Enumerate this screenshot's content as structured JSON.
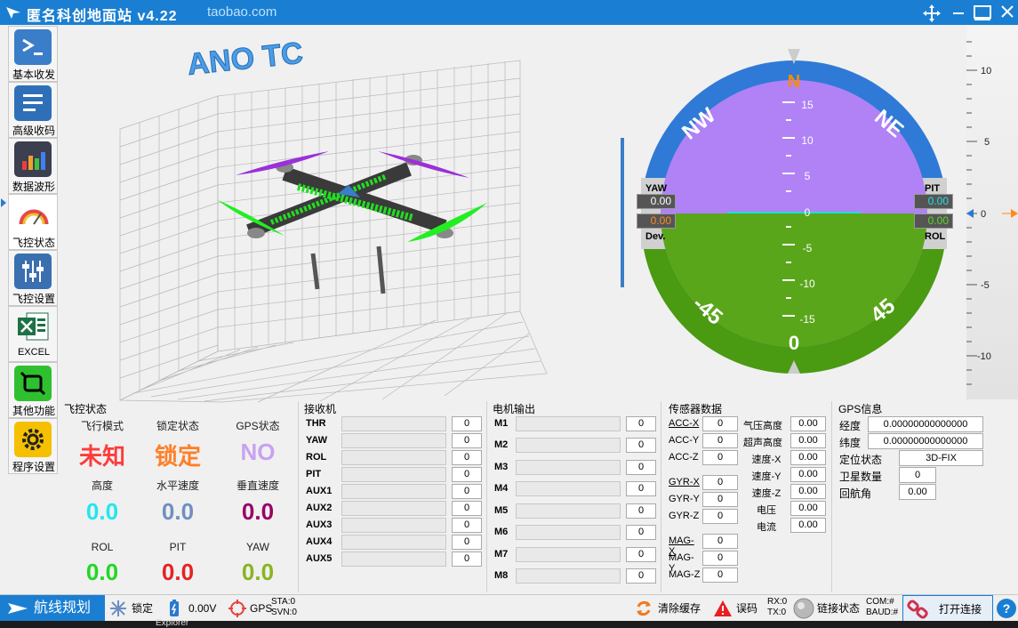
{
  "window": {
    "title": "匿名科创地面站 v4.22",
    "subtitle": "taobao.com"
  },
  "sidebar": {
    "items": [
      {
        "label": "基本收发"
      },
      {
        "label": "高级收码"
      },
      {
        "label": "数据波形"
      },
      {
        "label": "飞控状态"
      },
      {
        "label": "飞控设置"
      },
      {
        "label": "EXCEL"
      },
      {
        "label": "其他功能"
      },
      {
        "label": "程序设置"
      }
    ]
  },
  "view3d": {
    "logo": "ANO TC"
  },
  "hud": {
    "compass": [
      "N",
      "NE",
      "NW"
    ],
    "pitch_ticks": [
      "15",
      "10",
      "5",
      "0",
      "-5",
      "-10",
      "-15"
    ],
    "roll_labels": [
      "-45",
      "0",
      "45"
    ],
    "yaw_label": "YAW",
    "yaw_value": "0.00",
    "dev_value": "0.00",
    "dev_label": "Dev.",
    "pit_label": "PIT",
    "pit_value": "0.00",
    "rol_label": "ROL",
    "rol_value": "0.00"
  },
  "scale": {
    "ticks": [
      "10",
      "5",
      "0",
      "-5",
      "-10"
    ]
  },
  "flight_status": {
    "title": "飞控状态",
    "cells": [
      {
        "label": "飞行模式",
        "value": "未知",
        "color": "#ff3b3b"
      },
      {
        "label": "锁定状态",
        "value": "锁定",
        "color": "#ff7f27"
      },
      {
        "label": "GPS状态",
        "value": "NO",
        "color": "#c8a2f0"
      },
      {
        "label": "高度",
        "value": "0.0",
        "color": "#22e6f0"
      },
      {
        "label": "水平速度",
        "value": "0.0",
        "color": "#6f8fbf"
      },
      {
        "label": "垂直速度",
        "value": "0.0",
        "color": "#990066"
      },
      {
        "label": "ROL",
        "value": "0.0",
        "color": "#22d822"
      },
      {
        "label": "PIT",
        "value": "0.0",
        "color": "#e62222"
      },
      {
        "label": "YAW",
        "value": "0.0",
        "color": "#88b520"
      }
    ]
  },
  "receiver": {
    "title": "接收机",
    "channels": [
      {
        "name": "THR",
        "value": "0"
      },
      {
        "name": "YAW",
        "value": "0"
      },
      {
        "name": "ROL",
        "value": "0"
      },
      {
        "name": "PIT",
        "value": "0"
      },
      {
        "name": "AUX1",
        "value": "0"
      },
      {
        "name": "AUX2",
        "value": "0"
      },
      {
        "name": "AUX3",
        "value": "0"
      },
      {
        "name": "AUX4",
        "value": "0"
      },
      {
        "name": "AUX5",
        "value": "0"
      }
    ]
  },
  "motors": {
    "title": "电机输出",
    "channels": [
      {
        "name": "M1",
        "value": "0"
      },
      {
        "name": "M2",
        "value": "0"
      },
      {
        "name": "M3",
        "value": "0"
      },
      {
        "name": "M4",
        "value": "0"
      },
      {
        "name": "M5",
        "value": "0"
      },
      {
        "name": "M6",
        "value": "0"
      },
      {
        "name": "M7",
        "value": "0"
      },
      {
        "name": "M8",
        "value": "0"
      }
    ]
  },
  "sensors": {
    "title": "传感器数据",
    "left": [
      {
        "name": "ACC-X",
        "value": "0",
        "link": true
      },
      {
        "name": "ACC-Y",
        "value": "0"
      },
      {
        "name": "ACC-Z",
        "value": "0"
      },
      {
        "name": "GYR-X",
        "value": "0",
        "link": true
      },
      {
        "name": "GYR-Y",
        "value": "0"
      },
      {
        "name": "GYR-Z",
        "value": "0"
      },
      {
        "name": "MAG-X",
        "value": "0",
        "link": true
      },
      {
        "name": "MAG-Y",
        "value": "0"
      },
      {
        "name": "MAG-Z",
        "value": "0"
      }
    ],
    "right": [
      {
        "name": "气压高度",
        "value": "0.00"
      },
      {
        "name": "超声高度",
        "value": "0.00"
      },
      {
        "name": "速度-X",
        "value": "0.00"
      },
      {
        "name": "速度-Y",
        "value": "0.00"
      },
      {
        "name": "速度-Z",
        "value": "0.00"
      },
      {
        "name": "电压",
        "value": "0.00"
      },
      {
        "name": "电流",
        "value": "0.00"
      }
    ]
  },
  "gps": {
    "title": "GPS信息",
    "rows": [
      {
        "name": "经度",
        "value": "0.00000000000000"
      },
      {
        "name": "纬度",
        "value": "0.00000000000000"
      },
      {
        "name": "定位状态",
        "value": "3D-FIX"
      },
      {
        "name": "卫星数量",
        "value": "0"
      },
      {
        "name": "回航角",
        "value": "0.00"
      }
    ]
  },
  "statusbar": {
    "route": "航线规划",
    "lock": "锁定",
    "voltage": "0.00V",
    "gps": "GPS",
    "sta": "STA:0",
    "svn": "SVN:0",
    "clear": "清除缓存",
    "error": "误码",
    "rx": "RX:0",
    "tx": "TX:0",
    "link": "链接状态",
    "com": "COM:#",
    "baud": "BAUD:#",
    "connect": "打开连接",
    "help": "?"
  },
  "taskbar": {
    "text": "Explorer"
  }
}
